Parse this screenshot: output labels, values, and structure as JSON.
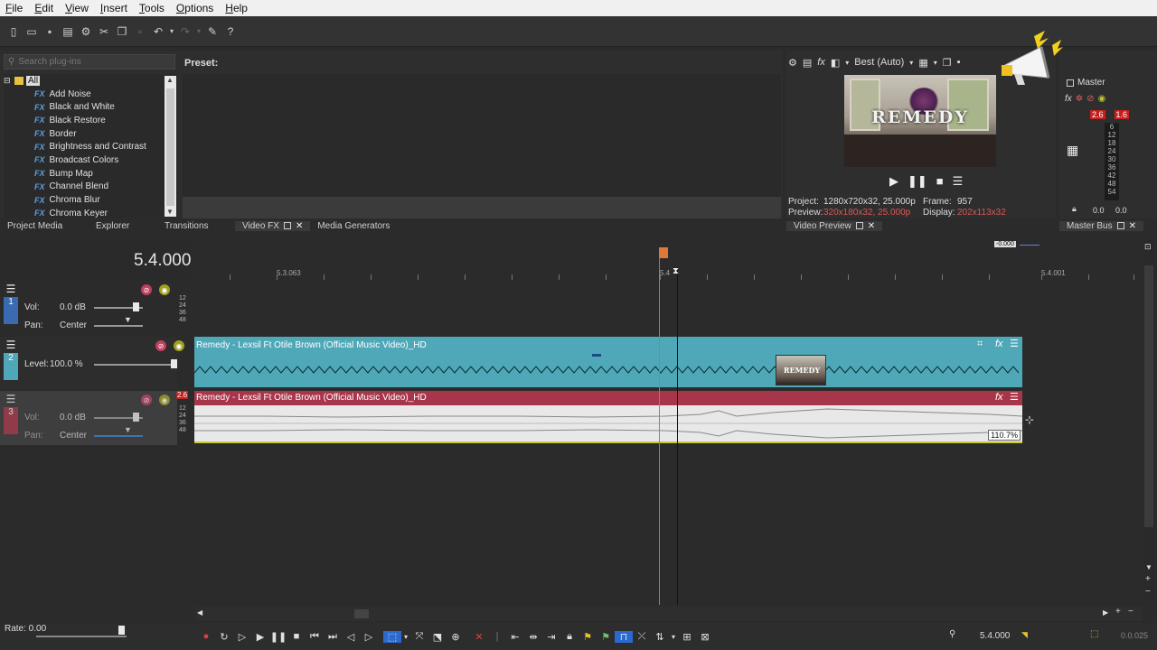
{
  "menu": [
    "File",
    "Edit",
    "View",
    "Insert",
    "Tools",
    "Options",
    "Help"
  ],
  "plugins": {
    "search_placeholder": "Search plug-ins",
    "root": "All",
    "items": [
      "Add Noise",
      "Black and White",
      "Black Restore",
      "Border",
      "Brightness and Contrast",
      "Broadcast Colors",
      "Bump Map",
      "Channel Blend",
      "Chroma Blur",
      "Chroma Keyer"
    ],
    "preset_label": "Preset:"
  },
  "panel_tabs": {
    "left": [
      "Project Media",
      "Explorer",
      "Transitions",
      "Video FX",
      "Media Generators"
    ],
    "preview": "Video Preview",
    "master": "Master Bus"
  },
  "preview": {
    "quality": "Best (Auto)",
    "thumb_title": "REMEDY",
    "project_label": "Project:",
    "project_value": "1280x720x32, 25.000p",
    "preview_label": "Preview:",
    "preview_value": "320x180x32, 25.000p",
    "frame_label": "Frame:",
    "frame_value": "957",
    "display_label": "Display:",
    "display_value": "202x113x32"
  },
  "master": {
    "label": "Master",
    "left_peak": "2.6",
    "right_peak": "1.6",
    "scale": [
      "6",
      "12",
      "18",
      "24",
      "30",
      "36",
      "42",
      "48",
      "54"
    ],
    "bottom_left": "0.0",
    "bottom_right": "0.0"
  },
  "timeline": {
    "timecode": "5.4.000",
    "ruler_labels": [
      "5.3.063",
      "5.4",
      "5.4.001"
    ],
    "top_right_value": "-0.000",
    "tracks": [
      {
        "number": "1",
        "vol_label": "Vol:",
        "vol_value": "0.0 dB",
        "pan_label": "Pan:",
        "pan_value": "Center",
        "scale": [
          "12",
          "24",
          "36",
          "48"
        ]
      },
      {
        "number": "2",
        "level_label": "Level:",
        "level_value": "100.0 %"
      },
      {
        "number": "3",
        "vol_label": "Vol:",
        "vol_value": "0.0 dB",
        "pan_label": "Pan:",
        "pan_value": "Center",
        "peak": "2.6",
        "scale": [
          "12",
          "24",
          "36",
          "48"
        ]
      }
    ],
    "video_clip_name": "Remedy - Lexsil Ft Otile Brown (Official Music Video)_HD",
    "audio_clip_name": "Remedy - Lexsil Ft Otile Brown (Official Music Video)_HD",
    "audio_percent": "110.7%",
    "thumb_title": "REMEDY"
  },
  "bottom": {
    "rate": "Rate: 0.00",
    "timecode": "5.4.000",
    "selection": "0.0.025"
  },
  "colors": {
    "video_clip": "#4fa8b8",
    "audio_header": "#a8364a",
    "cursor": "#d07030",
    "accent_blue": "#2a6ad0"
  }
}
